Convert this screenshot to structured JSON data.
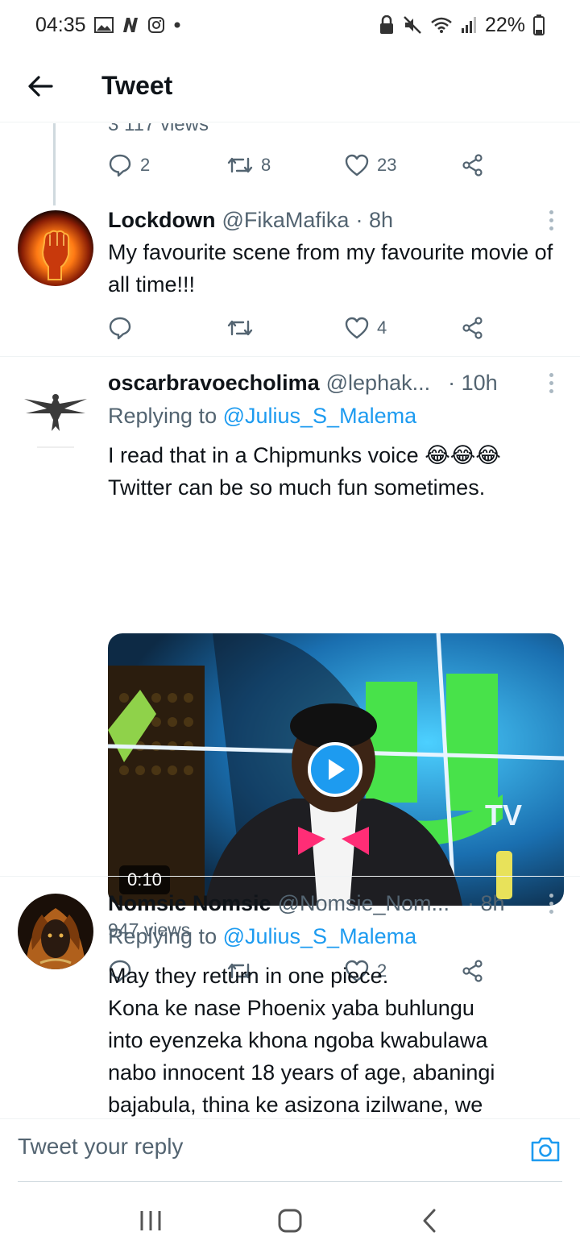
{
  "status_bar": {
    "time": "04:35",
    "battery": "22%"
  },
  "header": {
    "title": "Tweet"
  },
  "prev_tweet": {
    "views_partial": "3 117 views",
    "replies": "2",
    "retweets": "8",
    "likes": "23"
  },
  "tweets": [
    {
      "name": "Lockdown",
      "handle": "@FikaMafika",
      "time": "· 8h",
      "text": "My favourite scene from my favourite movie of all time!!!",
      "replies": "",
      "retweets": "",
      "likes": "4"
    },
    {
      "name": "oscarbravoecholima",
      "handle": "@lephak...",
      "time": "· 10h",
      "reply_prefix": "Replying to ",
      "reply_to": "@Julius_S_Malema",
      "text_line1": "I read that in a Chipmunks voice 😂😂😂",
      "text_line2": "Twitter can be so much fun sometimes.",
      "video_duration": "0:10",
      "views": "947 views",
      "replies": "",
      "retweets": "",
      "likes": "2"
    },
    {
      "name": "Nomsie Nomsie",
      "handle": "@Nomsie_Nom...",
      "time": "· 8h",
      "reply_prefix": "Replying to ",
      "reply_to": "@Julius_S_Malema",
      "text_lines": [
        "May they return in one piece.",
        "Kona ke nase Phoenix yaba buhlungu",
        "into eyenzeka khona ngoba kwabulawa",
        "nabo innocent 18 years of age, abaningi",
        "bajabula, thina ke asizona izilwane, we"
      ]
    }
  ],
  "reply_bar": {
    "placeholder": "Tweet your reply"
  },
  "colors": {
    "accent": "#1d9bf0",
    "muted": "#536471",
    "text": "#0f1419"
  }
}
